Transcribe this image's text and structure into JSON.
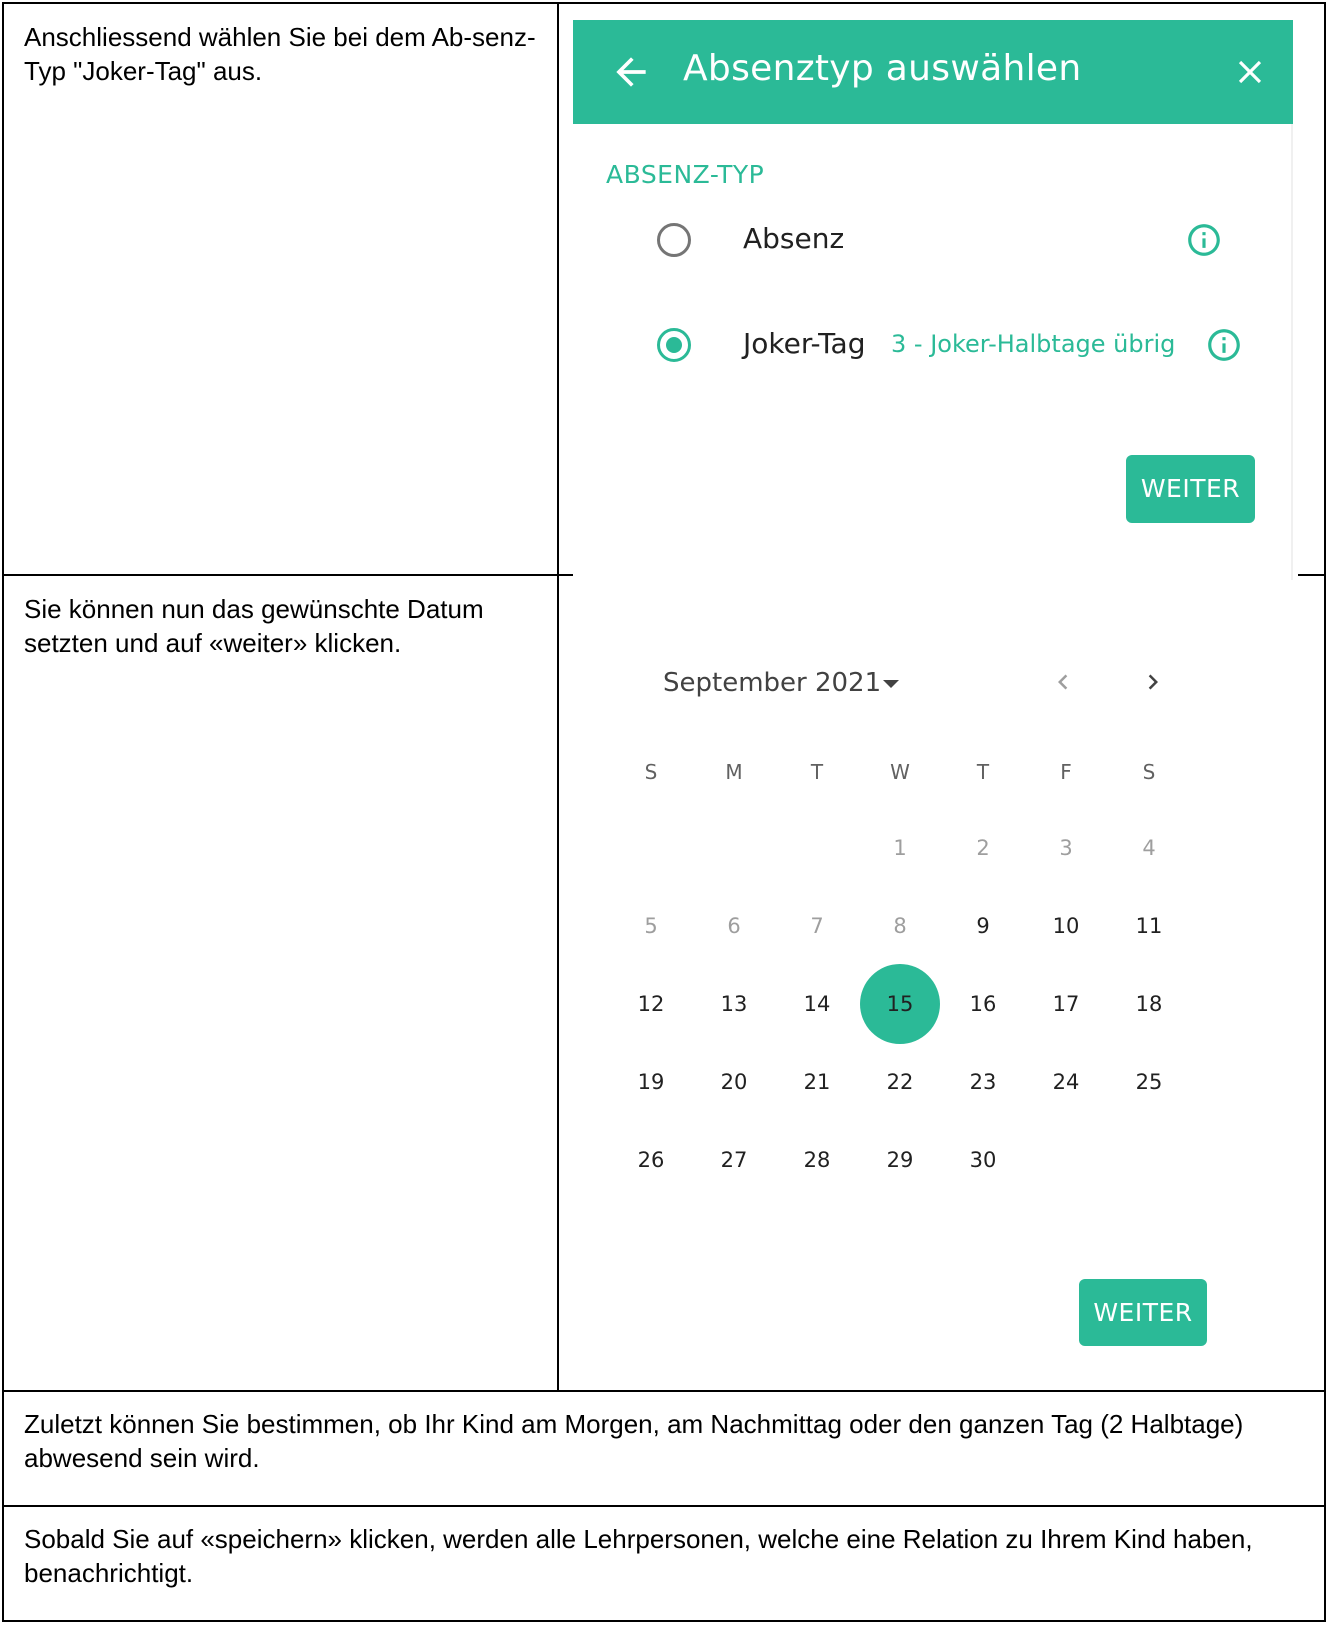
{
  "rows": {
    "row1_text": "Anschliessend wählen Sie bei dem Ab-senz-Typ \"Joker-Tag\" aus.",
    "row2_text": "Sie können nun das gewünschte Datum setzten und auf «weiter» klicken.",
    "row3_text": "Zuletzt können Sie bestimmen, ob Ihr Kind am Morgen, am Nachmittag oder den ganzen Tag (2 Halbtage) abwesend sein wird.",
    "row4_text": "Sobald Sie auf «speichern» klicken, werden alle Lehrpersonen, welche eine Relation zu Ihrem Kind haben, benachrichtigt."
  },
  "absence_dialog": {
    "title": "Absenztyp auswählen",
    "section_label": "ABSENZ-TYP",
    "options": [
      {
        "label": "Absenz",
        "extra": "",
        "selected": false
      },
      {
        "label": "Joker-Tag",
        "extra": "3 - Joker-Halbtage übrig",
        "selected": true
      }
    ],
    "next_button": "WEITER",
    "accent_color": "#2bba97"
  },
  "calendar": {
    "month_label": "September 2021",
    "weekdays": [
      "S",
      "M",
      "T",
      "W",
      "T",
      "F",
      "S"
    ],
    "weeks": [
      [
        "",
        "",
        "",
        "1",
        "2",
        "3",
        "4"
      ],
      [
        "5",
        "6",
        "7",
        "8",
        "9",
        "10",
        "11"
      ],
      [
        "12",
        "13",
        "14",
        "15",
        "16",
        "17",
        "18"
      ],
      [
        "19",
        "20",
        "21",
        "22",
        "23",
        "24",
        "25"
      ],
      [
        "26",
        "27",
        "28",
        "29",
        "30",
        "",
        ""
      ]
    ],
    "disabled_days": [
      "1",
      "2",
      "3",
      "4",
      "5",
      "6",
      "7",
      "8"
    ],
    "selected_day": "15",
    "next_button": "WEITER"
  }
}
